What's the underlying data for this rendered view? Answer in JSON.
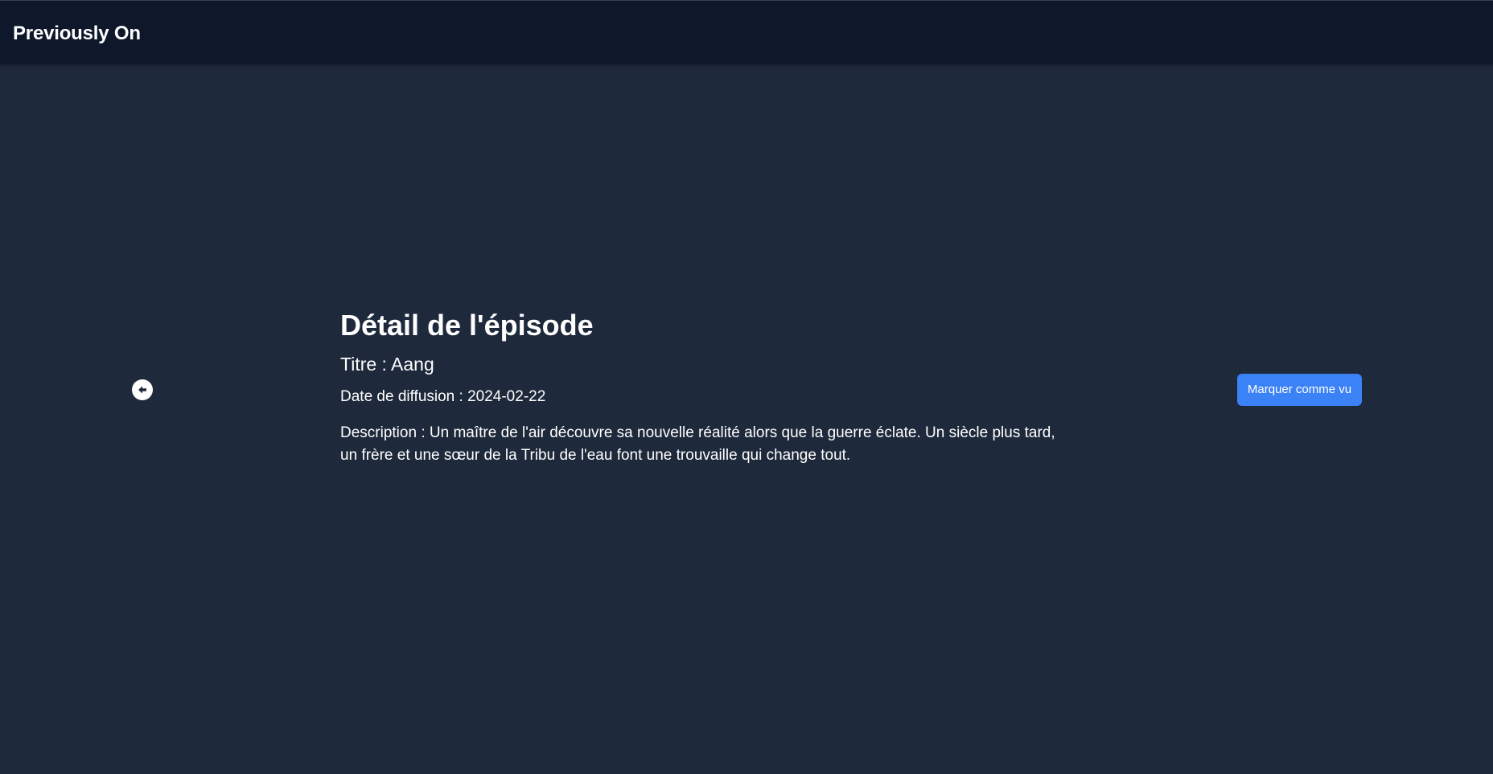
{
  "header": {
    "brand": "Previously On"
  },
  "episode": {
    "heading": "Détail de l'épisode",
    "title_line": "Titre : Aang",
    "date_line": "Date de diffusion : 2024-02-22",
    "description_line": "Description : Un maître de l'air découvre sa nouvelle réalité alors que la guerre éclate. Un siècle plus tard, un frère et une sœur de la Tribu de l'eau font une trouvaille qui change tout."
  },
  "actions": {
    "back_icon": "arrow-left-circle-icon",
    "mark_watched_label": "Marquer comme vu"
  },
  "colors": {
    "background": "#1e293b",
    "navbar": "#0f172a",
    "accent": "#3b82f6",
    "text": "#ffffff"
  }
}
